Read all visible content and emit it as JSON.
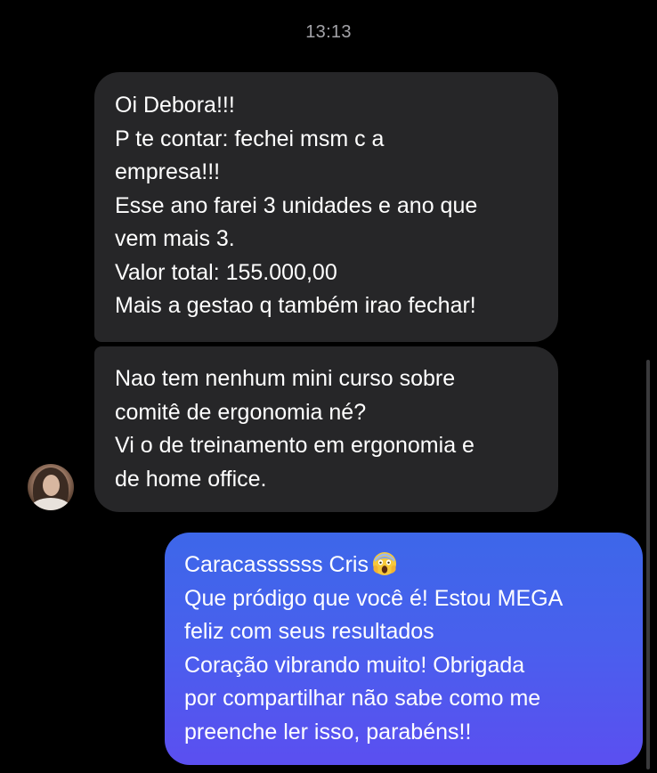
{
  "chat": {
    "timestamp": "13:13",
    "messages": [
      {
        "direction": "incoming",
        "lines": [
          "Oi Debora!!!",
          "P te contar: fechei msm c a",
          "empresa!!!",
          "Esse ano farei 3 unidades e ano que",
          "vem mais 3.",
          "Valor total: 155.000,00",
          "Mais a gestao q também irao fechar!"
        ]
      },
      {
        "direction": "incoming",
        "lines": [
          "Nao tem nenhum mini curso sobre",
          "comitê de ergonomia né?",
          "Vi o de treinamento em ergonomia e",
          "de home office."
        ]
      },
      {
        "direction": "outgoing",
        "lines": [
          "Caracassssss Cris",
          "Que pródigo que você é! Estou MEGA",
          "feliz com seus resultados",
          "Coração vibrando muito! Obrigada",
          "por compartilhar não sabe como me",
          "preenche ler isso, parabéns!!"
        ],
        "emoji": "face-screaming-in-fear-icon"
      }
    ],
    "contact_avatar": "avatar-photo"
  },
  "colors": {
    "background": "#000000",
    "incoming_bubble": "#262628",
    "outgoing_bubble_top": "#3d67e9",
    "outgoing_bubble_bottom": "#5b4ff0",
    "timestamp_text": "#a3a3a8",
    "message_text": "#ffffff"
  }
}
